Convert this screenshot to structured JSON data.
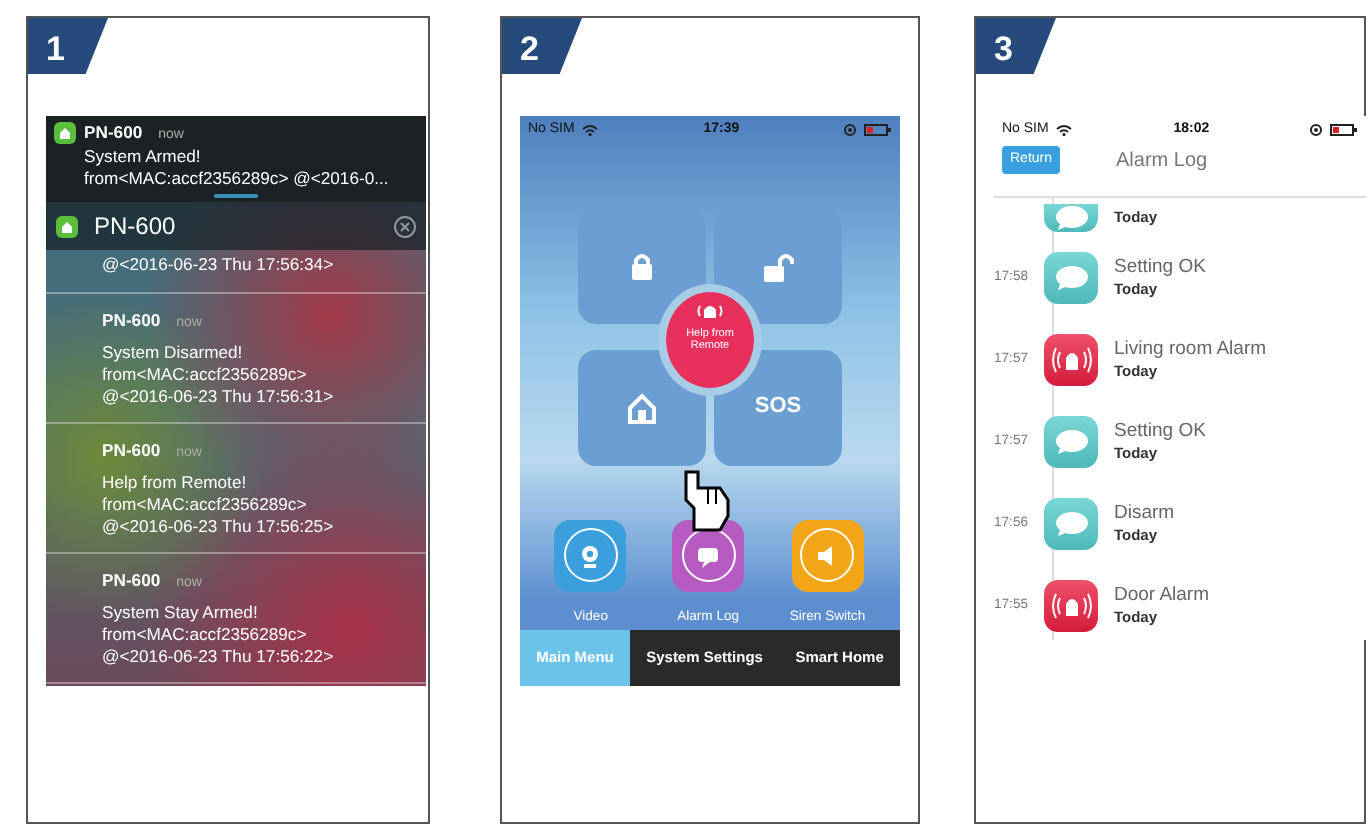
{
  "panels": [
    {
      "number": "1",
      "kind": "notifications",
      "banner": {
        "app": "PN-600",
        "time": "now",
        "title": "System Armed!",
        "body": "from<MAC:accf2356289c> @<2016-0..."
      },
      "header": {
        "app": "PN-600"
      },
      "continued": "@<2016-06-23 Thu 17:56:34>",
      "notifications": [
        {
          "app": "PN-600",
          "time": "now",
          "title": "System Disarmed!",
          "lines": [
            "from<MAC:accf2356289c>",
            "@<2016-06-23 Thu 17:56:31>"
          ]
        },
        {
          "app": "PN-600",
          "time": "now",
          "title": "Help from Remote!",
          "lines": [
            "from<MAC:accf2356289c>",
            "@<2016-06-23 Thu 17:56:25>"
          ]
        },
        {
          "app": "PN-600",
          "time": "now",
          "title": "System Stay Armed!",
          "lines": [
            "from<MAC:accf2356289c>",
            "@<2016-06-23 Thu 17:56:22>"
          ]
        }
      ]
    },
    {
      "number": "2",
      "kind": "main_menu",
      "status": {
        "carrier": "No SIM",
        "time": "17:39"
      },
      "center": "Help from Remote",
      "sos": "SOS",
      "apps": [
        {
          "label": "Video",
          "color": "#3a9fdc"
        },
        {
          "label": "Alarm Log",
          "color": "#b65bc2"
        },
        {
          "label": "Siren Switch",
          "color": "#f2a516"
        }
      ],
      "tabs": [
        {
          "label": "Main Menu",
          "selected": true
        },
        {
          "label": "System Settings",
          "selected": false
        },
        {
          "label": "Smart Home",
          "selected": false
        }
      ]
    },
    {
      "number": "3",
      "kind": "alarm_log",
      "status": {
        "carrier": "No SIM",
        "time": "18:02"
      },
      "back": "Return",
      "title": "Alarm Log",
      "entries": [
        {
          "kind": "message",
          "subtitle": "Today"
        },
        {
          "time": "17:58",
          "kind": "message",
          "title": "Setting OK",
          "subtitle": "Today"
        },
        {
          "time": "17:57",
          "kind": "alarm",
          "title": "Living room Alarm",
          "subtitle": "Today"
        },
        {
          "time": "17:57",
          "kind": "message",
          "title": "Setting OK",
          "subtitle": "Today"
        },
        {
          "time": "17:56",
          "kind": "message",
          "title": "Disarm",
          "subtitle": "Today"
        },
        {
          "time": "17:55",
          "kind": "alarm",
          "title": "Door Alarm",
          "subtitle": "Today"
        }
      ]
    }
  ]
}
